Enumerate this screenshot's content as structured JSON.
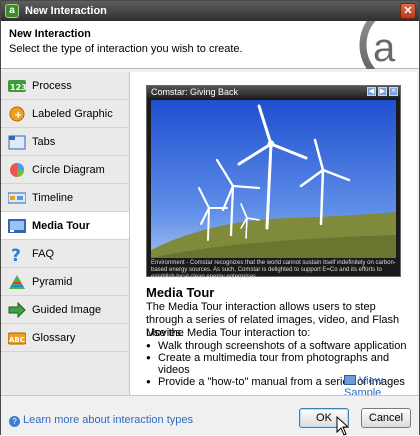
{
  "window": {
    "title": "New Interaction"
  },
  "header": {
    "title": "New Interaction",
    "subtitle": "Select the type of interaction you wish to create."
  },
  "sidebar": {
    "items": [
      {
        "label": "Process",
        "icon": "process-icon"
      },
      {
        "label": "Labeled Graphic",
        "icon": "labeled-graphic-icon"
      },
      {
        "label": "Tabs",
        "icon": "tabs-icon"
      },
      {
        "label": "Circle Diagram",
        "icon": "circle-diagram-icon"
      },
      {
        "label": "Timeline",
        "icon": "timeline-icon"
      },
      {
        "label": "Media Tour",
        "icon": "media-tour-icon",
        "selected": true
      },
      {
        "label": "FAQ",
        "icon": "faq-icon"
      },
      {
        "label": "Pyramid",
        "icon": "pyramid-icon"
      },
      {
        "label": "Guided Image",
        "icon": "guided-image-icon"
      },
      {
        "label": "Glossary",
        "icon": "glossary-icon"
      }
    ]
  },
  "preview": {
    "caption": "Comstar: Giving Back",
    "footer_text": "Environment - Comstar recognizes that the world cannot sustain itself indefinitely on carbon-based energy sources. As such, Comstar is delighted to support E=Co and its efforts to establish local clean energy enterprises."
  },
  "detail": {
    "title": "Media Tour",
    "description": "The Media Tour interaction allows users to step through a series of related images, video, and Flash Movies.",
    "use_heading": "Use the Media Tour interaction to:",
    "bullets": [
      "Walk through screenshots of a software application",
      "Create a multimedia tour from photographs and videos",
      "Provide a \"how-to\" manual from a series of images"
    ],
    "view_sample": "View Sample"
  },
  "footer": {
    "learn_more": "Learn more about interaction types",
    "ok_label": "OK",
    "cancel_label": "Cancel"
  }
}
